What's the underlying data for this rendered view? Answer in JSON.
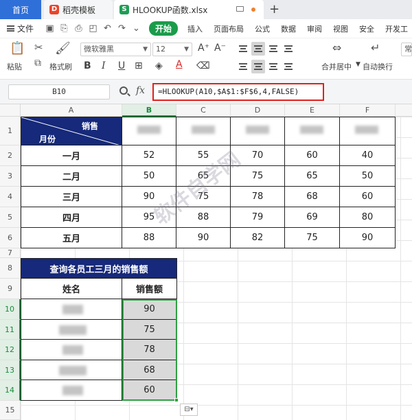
{
  "tabs": {
    "home": "首页",
    "template": "稻壳模板",
    "file": "HLOOKUP函数.xlsx"
  },
  "menu": {
    "file": "文件",
    "start": "开始",
    "items": [
      "插入",
      "页面布局",
      "公式",
      "数据",
      "审阅",
      "视图",
      "安全",
      "开发工"
    ]
  },
  "toolbar": {
    "paste": "粘贴",
    "format_painter": "格式刷",
    "font_name": "微软雅黑",
    "font_size": "12",
    "merge_center": "合并居中",
    "wrap_text": "自动换行",
    "number_format": "常",
    "bold": "B",
    "italic": "I",
    "underline": "U"
  },
  "formula_bar": {
    "cell_ref": "B10",
    "fx": "fx",
    "formula": "=HLOOKUP(A10,$A$1:$F$6,4,FALSE)"
  },
  "columns": [
    "A",
    "B",
    "C",
    "D",
    "E",
    "F"
  ],
  "rows": [
    "1",
    "2",
    "3",
    "4",
    "5",
    "6",
    "7",
    "8",
    "9",
    "10",
    "11",
    "12",
    "13",
    "14",
    "15"
  ],
  "sales_table": {
    "header_top": "销售",
    "header_bottom": "月份",
    "months": [
      "一月",
      "二月",
      "三月",
      "四月",
      "五月"
    ],
    "values": [
      [
        "52",
        "55",
        "70",
        "60",
        "40"
      ],
      [
        "50",
        "65",
        "75",
        "65",
        "50"
      ],
      [
        "90",
        "75",
        "78",
        "68",
        "60"
      ],
      [
        "95",
        "88",
        "79",
        "69",
        "80"
      ],
      [
        "88",
        "90",
        "82",
        "75",
        "90"
      ]
    ]
  },
  "query_table": {
    "title": "查询各员工三月的销售额",
    "col_name": "姓名",
    "col_sales": "销售额",
    "results": [
      "90",
      "75",
      "78",
      "68",
      "60"
    ]
  },
  "colors": {
    "header_navy": "#16297a",
    "accent_green": "#1a9c4a",
    "formula_highlight": "#e0201c",
    "tab_home": "#2f6fd8"
  }
}
